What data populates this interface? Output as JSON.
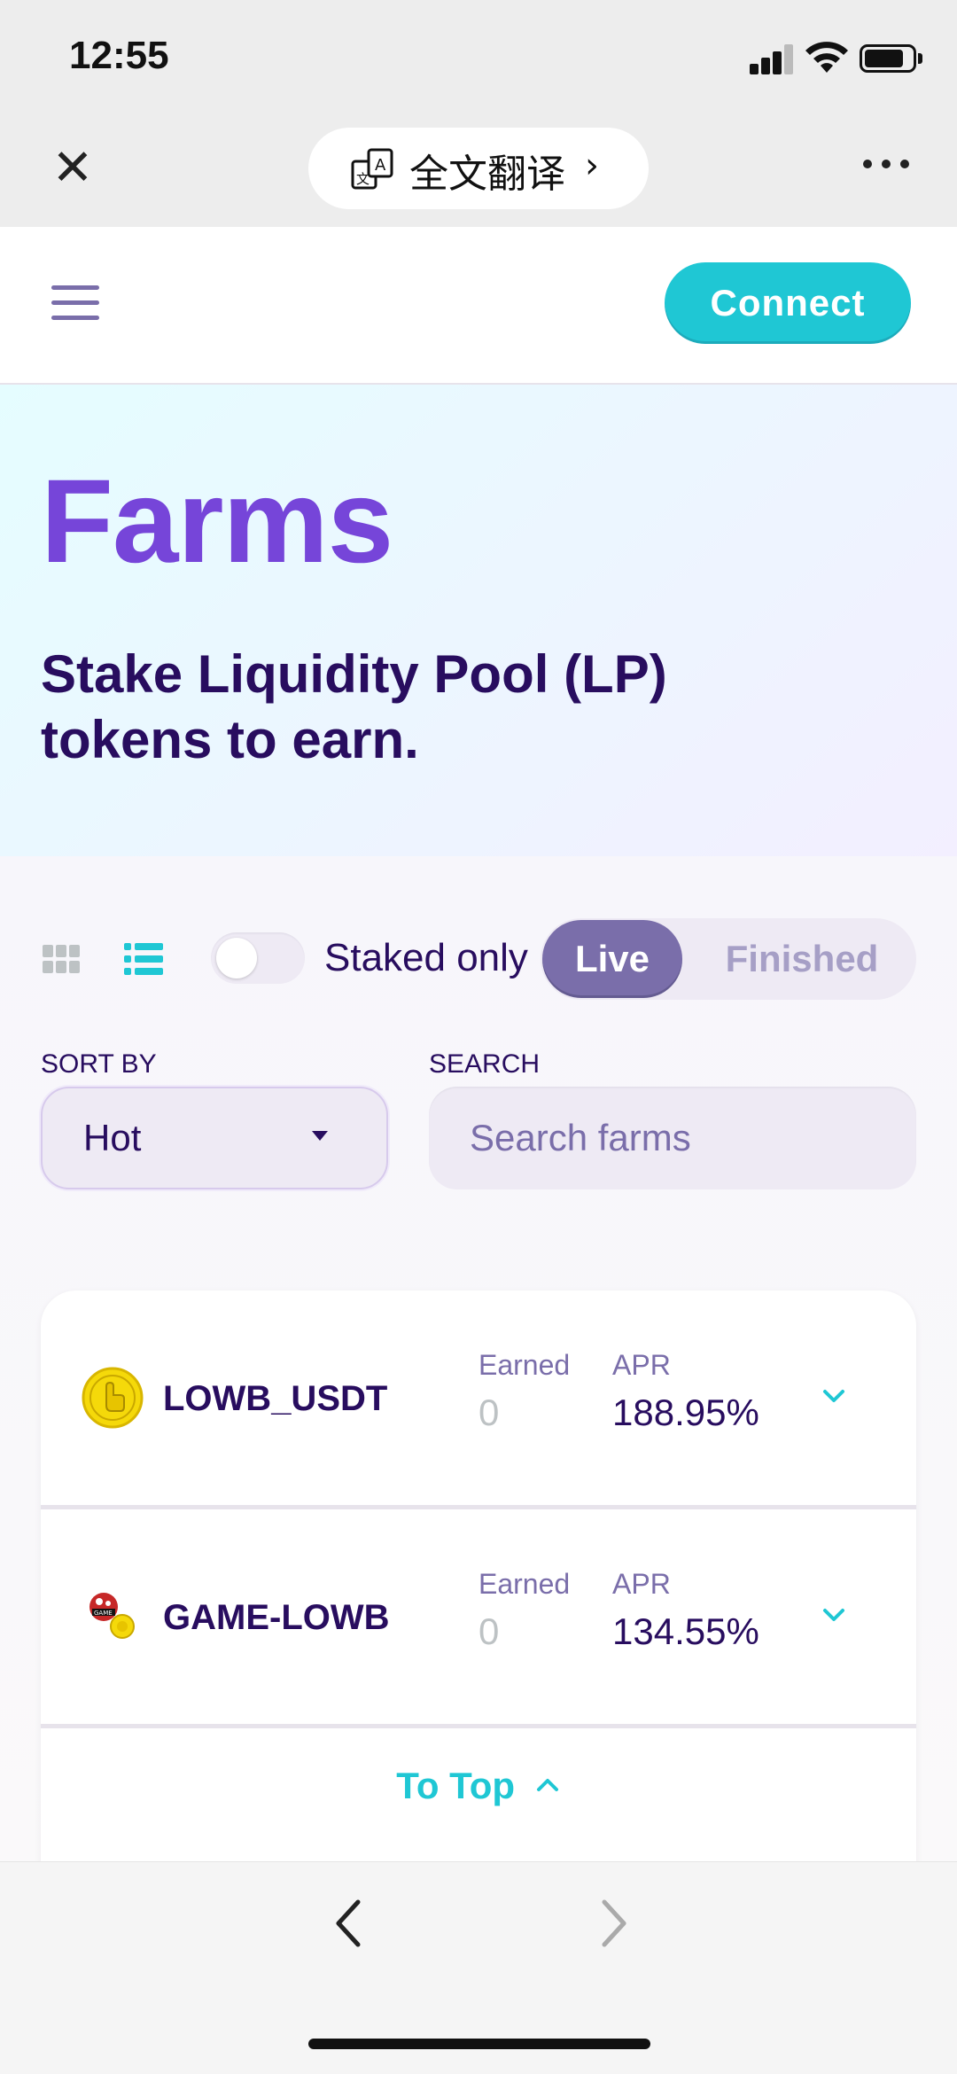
{
  "status_bar": {
    "time": "12:55"
  },
  "browser_bar": {
    "translate_label": "全文翻译"
  },
  "header": {
    "connect_label": "Connect"
  },
  "hero": {
    "title": "Farms",
    "subtitle_line1": "Stake Liquidity Pool (LP)",
    "subtitle_line2": "tokens to earn."
  },
  "controls": {
    "staked_only_label": "Staked only",
    "staked_only_on": false,
    "tabs": [
      {
        "label": "Live",
        "active": true
      },
      {
        "label": "Finished",
        "active": false
      }
    ],
    "sort_by_label": "SORT BY",
    "sort_value": "Hot",
    "search_label": "SEARCH",
    "search_placeholder": "Search farms"
  },
  "farms": [
    {
      "name": "LOWB_USDT",
      "earned_label": "Earned",
      "earned": "0",
      "apr_label": "APR",
      "apr": "188.95%"
    },
    {
      "name": "GAME-LOWB",
      "earned_label": "Earned",
      "earned": "0",
      "apr_label": "APR",
      "apr": "134.55%"
    }
  ],
  "to_top_label": "To Top",
  "colors": {
    "primary": "#1fc7d4",
    "secondary": "#7645d9",
    "text": "#280d5f",
    "text_subtle": "#7a6eaa"
  }
}
